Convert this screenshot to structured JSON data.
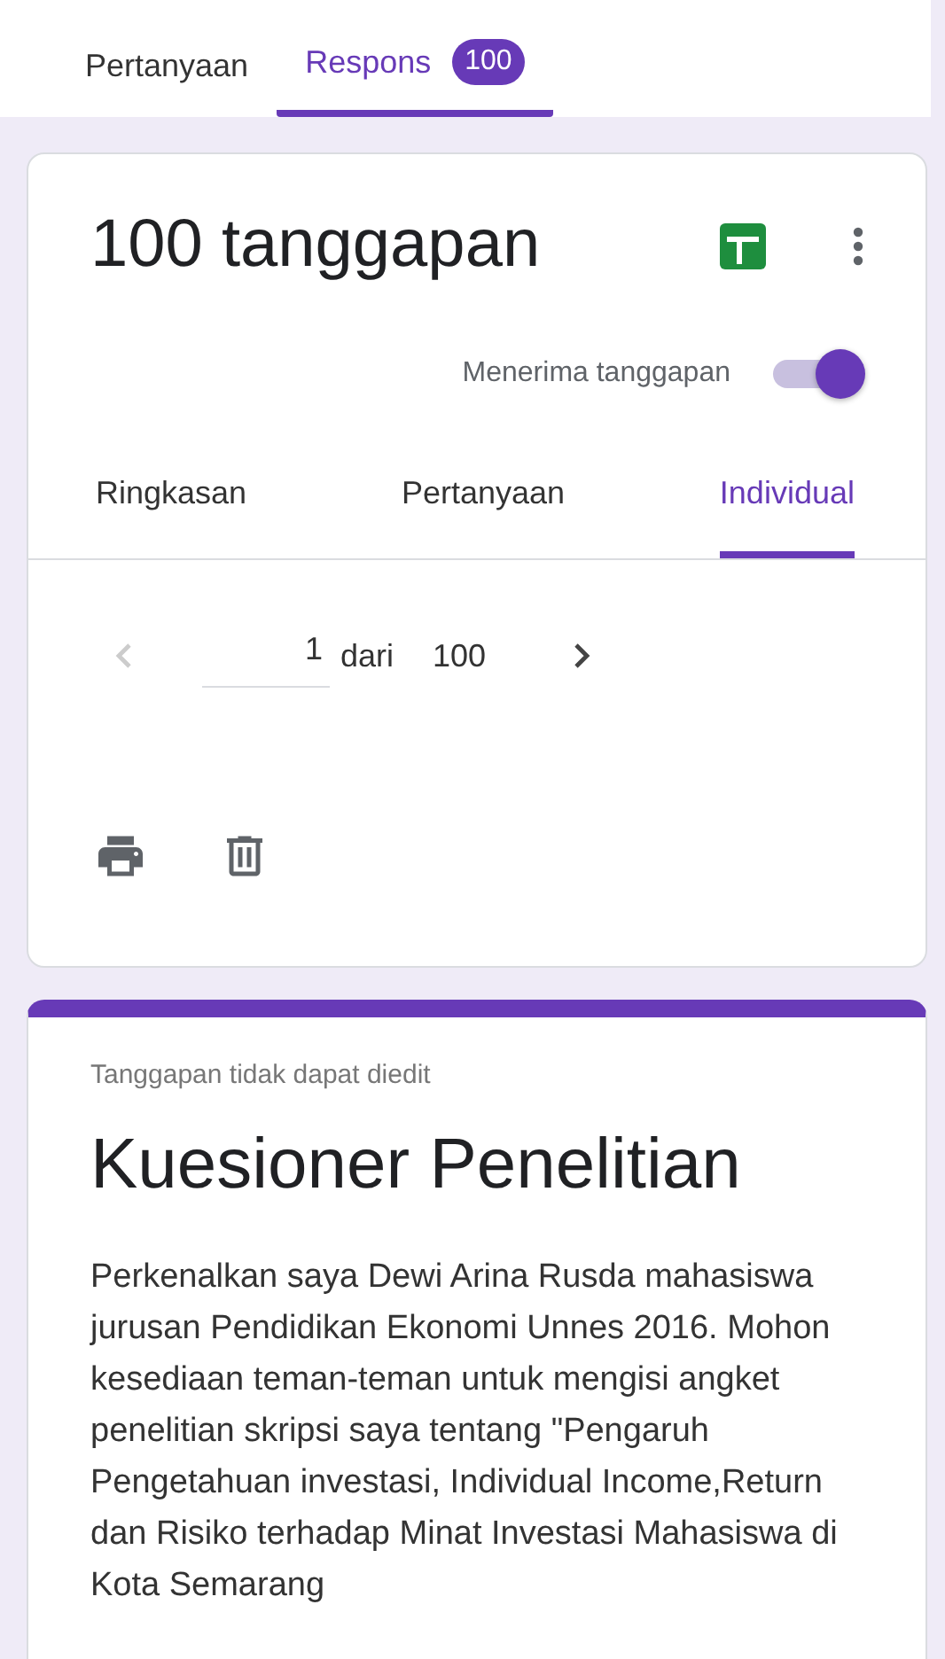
{
  "top_tabs": [
    {
      "label": "Pertanyaan",
      "selected": false
    },
    {
      "label": "Respons",
      "selected": true,
      "badge": "100"
    }
  ],
  "summary": {
    "title": "100 tanggapan",
    "accepting": {
      "label": "Menerima tanggapan",
      "on": true
    },
    "tabs": [
      {
        "label": "Ringkasan",
        "selected": false
      },
      {
        "label": "Pertanyaan",
        "selected": false
      },
      {
        "label": "Individual",
        "selected": true
      }
    ],
    "pager": {
      "previous_disabled": true,
      "value": "1",
      "of": "dari",
      "total": "100",
      "next_disabled": false
    }
  },
  "response": {
    "notice": "Tanggapan tidak dapat diedit",
    "title": "Kuesioner Penelitian",
    "description": "Perkenalkan saya Dewi Arina Rusda mahasiswa jurusan Pendidikan Ekonomi Unnes 2016. Mohon kesediaan teman-teman untuk mengisi angket penelitian skripsi saya tentang \"Pengaruh Pengetahuan investasi, Individual Income,Return dan Risiko terhadap Minat Investasi Mahasiswa di Kota Semarang"
  }
}
